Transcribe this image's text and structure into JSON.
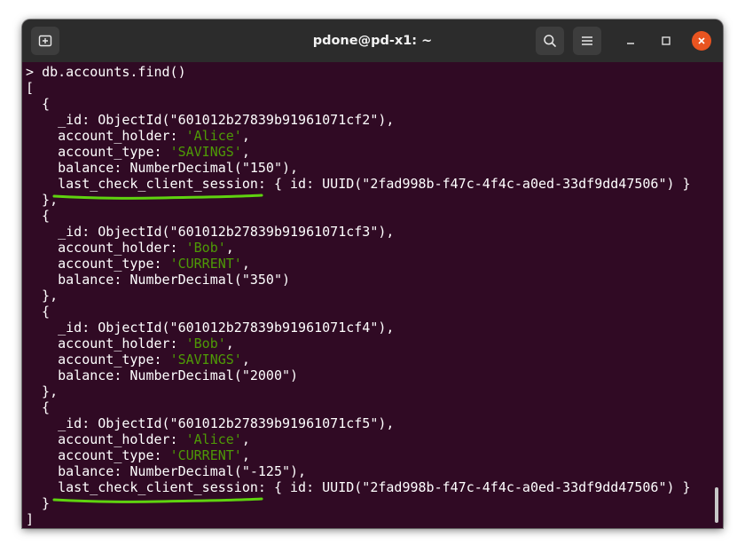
{
  "window": {
    "title": "pdone@pd-x1: ~",
    "buttons": {
      "new_tab_icon": "new-tab-icon",
      "search_icon": "search-icon",
      "menu_icon": "hamburger-menu-icon"
    }
  },
  "terminal": {
    "prompt": "> ",
    "command": "db.accounts.find()",
    "open_bracket": "[",
    "close_bracket": "]",
    "documents": [
      {
        "id_value": "601012b27839b91961071cf2",
        "account_holder": "Alice",
        "account_type": "SAVINGS",
        "balance": "150",
        "session_uuid": "2fad998b-f47c-4f4c-a0ed-33df9dd47506",
        "closing": "},"
      },
      {
        "id_value": "601012b27839b91961071cf3",
        "account_holder": "Bob",
        "account_type": "CURRENT",
        "balance": "350",
        "session_uuid": null,
        "closing": "},"
      },
      {
        "id_value": "601012b27839b91961071cf4",
        "account_holder": "Bob",
        "account_type": "SAVINGS",
        "balance": "2000",
        "session_uuid": null,
        "closing": "},"
      },
      {
        "id_value": "601012b27839b91961071cf5",
        "account_holder": "Alice",
        "account_type": "CURRENT",
        "balance": "-125",
        "session_uuid": "2fad998b-f47c-4f4c-a0ed-33df9dd47506",
        "closing": "}"
      }
    ]
  },
  "colors": {
    "terminal_bg": "#300a24",
    "titlebar_bg": "#2c2c2c",
    "string_green": "#4e9a06",
    "close_orange": "#e95420",
    "annotation_green": "#5fd30f"
  }
}
